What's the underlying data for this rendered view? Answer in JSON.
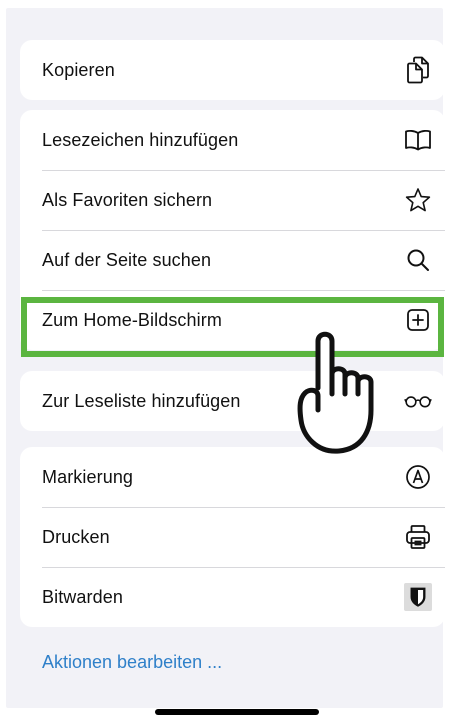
{
  "menu": {
    "group1": [
      {
        "label": "Kopieren",
        "icon": "copy-icon"
      }
    ],
    "group2": [
      {
        "label": "Lesezeichen hinzufügen",
        "icon": "book-icon"
      },
      {
        "label": "Als Favoriten sichern",
        "icon": "star-icon"
      },
      {
        "label": "Auf der Seite suchen",
        "icon": "search-icon"
      },
      {
        "label": "Zum Home-Bildschirm",
        "icon": "add-square-icon"
      }
    ],
    "group3": [
      {
        "label": "Zur Leseliste hinzufügen",
        "icon": "glasses-icon"
      }
    ],
    "group4": [
      {
        "label": "Markierung",
        "icon": "markup-pen-icon"
      },
      {
        "label": "Drucken",
        "icon": "printer-icon"
      },
      {
        "label": "Bitwarden",
        "icon": "bitwarden-shield-icon"
      }
    ]
  },
  "footer": {
    "edit_actions_label": "Aktionen bearbeiten ..."
  },
  "highlight": {
    "target": "Zum Home-Bildschirm",
    "color": "#5bb540"
  },
  "colors": {
    "link": "#2f80c9",
    "sheet_background": "#f2f2f7"
  }
}
